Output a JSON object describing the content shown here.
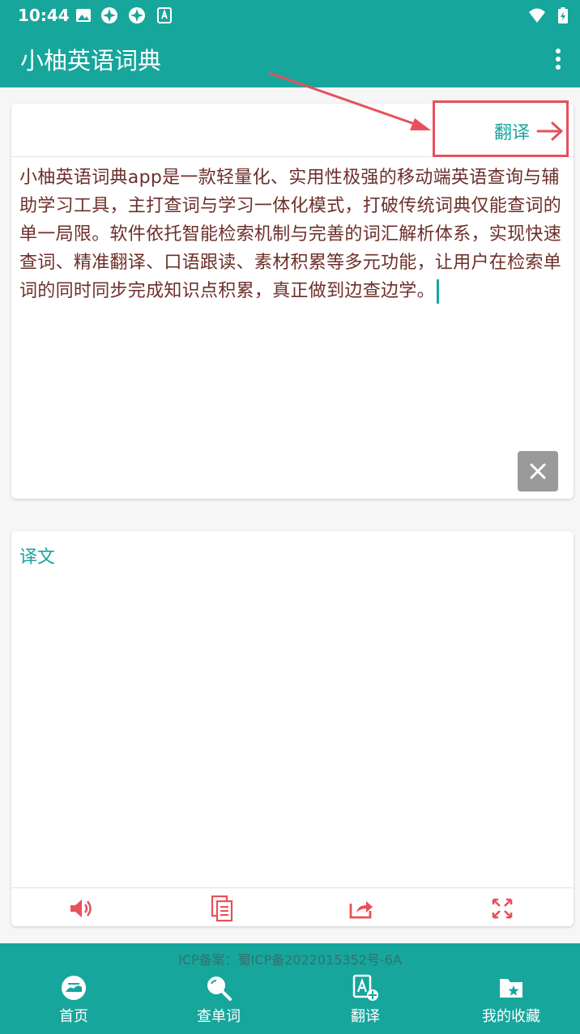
{
  "status_bar": {
    "time": "10:44"
  },
  "app_bar": {
    "title": "小柚英语词典"
  },
  "input_card": {
    "translate_label": "翻译",
    "text": "小柚英语词典app是一款轻量化、实用性极强的移动端英语查询与辅助学习工具，主打查词与学习一体化模式，打破传统词典仅能查词的单一局限。软件依托智能检索机制与完善的词汇解析体系，实现快速查词、精准翻译、口语跟读、素材积累等多元功能，让用户在检索单词的同时同步完成知识点积累，真正做到边查边学。"
  },
  "output_card": {
    "label": "译文"
  },
  "footer": {
    "icp": "ICP备案：蜀ICP备2022015352号-6A"
  },
  "bottom_nav": [
    {
      "label": "首页",
      "icon": "home-icon"
    },
    {
      "label": "查单词",
      "icon": "search-icon"
    },
    {
      "label": "翻译",
      "icon": "translate-icon"
    },
    {
      "label": "我的收藏",
      "icon": "favorites-folder-icon"
    }
  ],
  "colors": {
    "primary": "#16a69c",
    "accent_red": "#e8505b",
    "text_brown": "#6d2f2a"
  }
}
